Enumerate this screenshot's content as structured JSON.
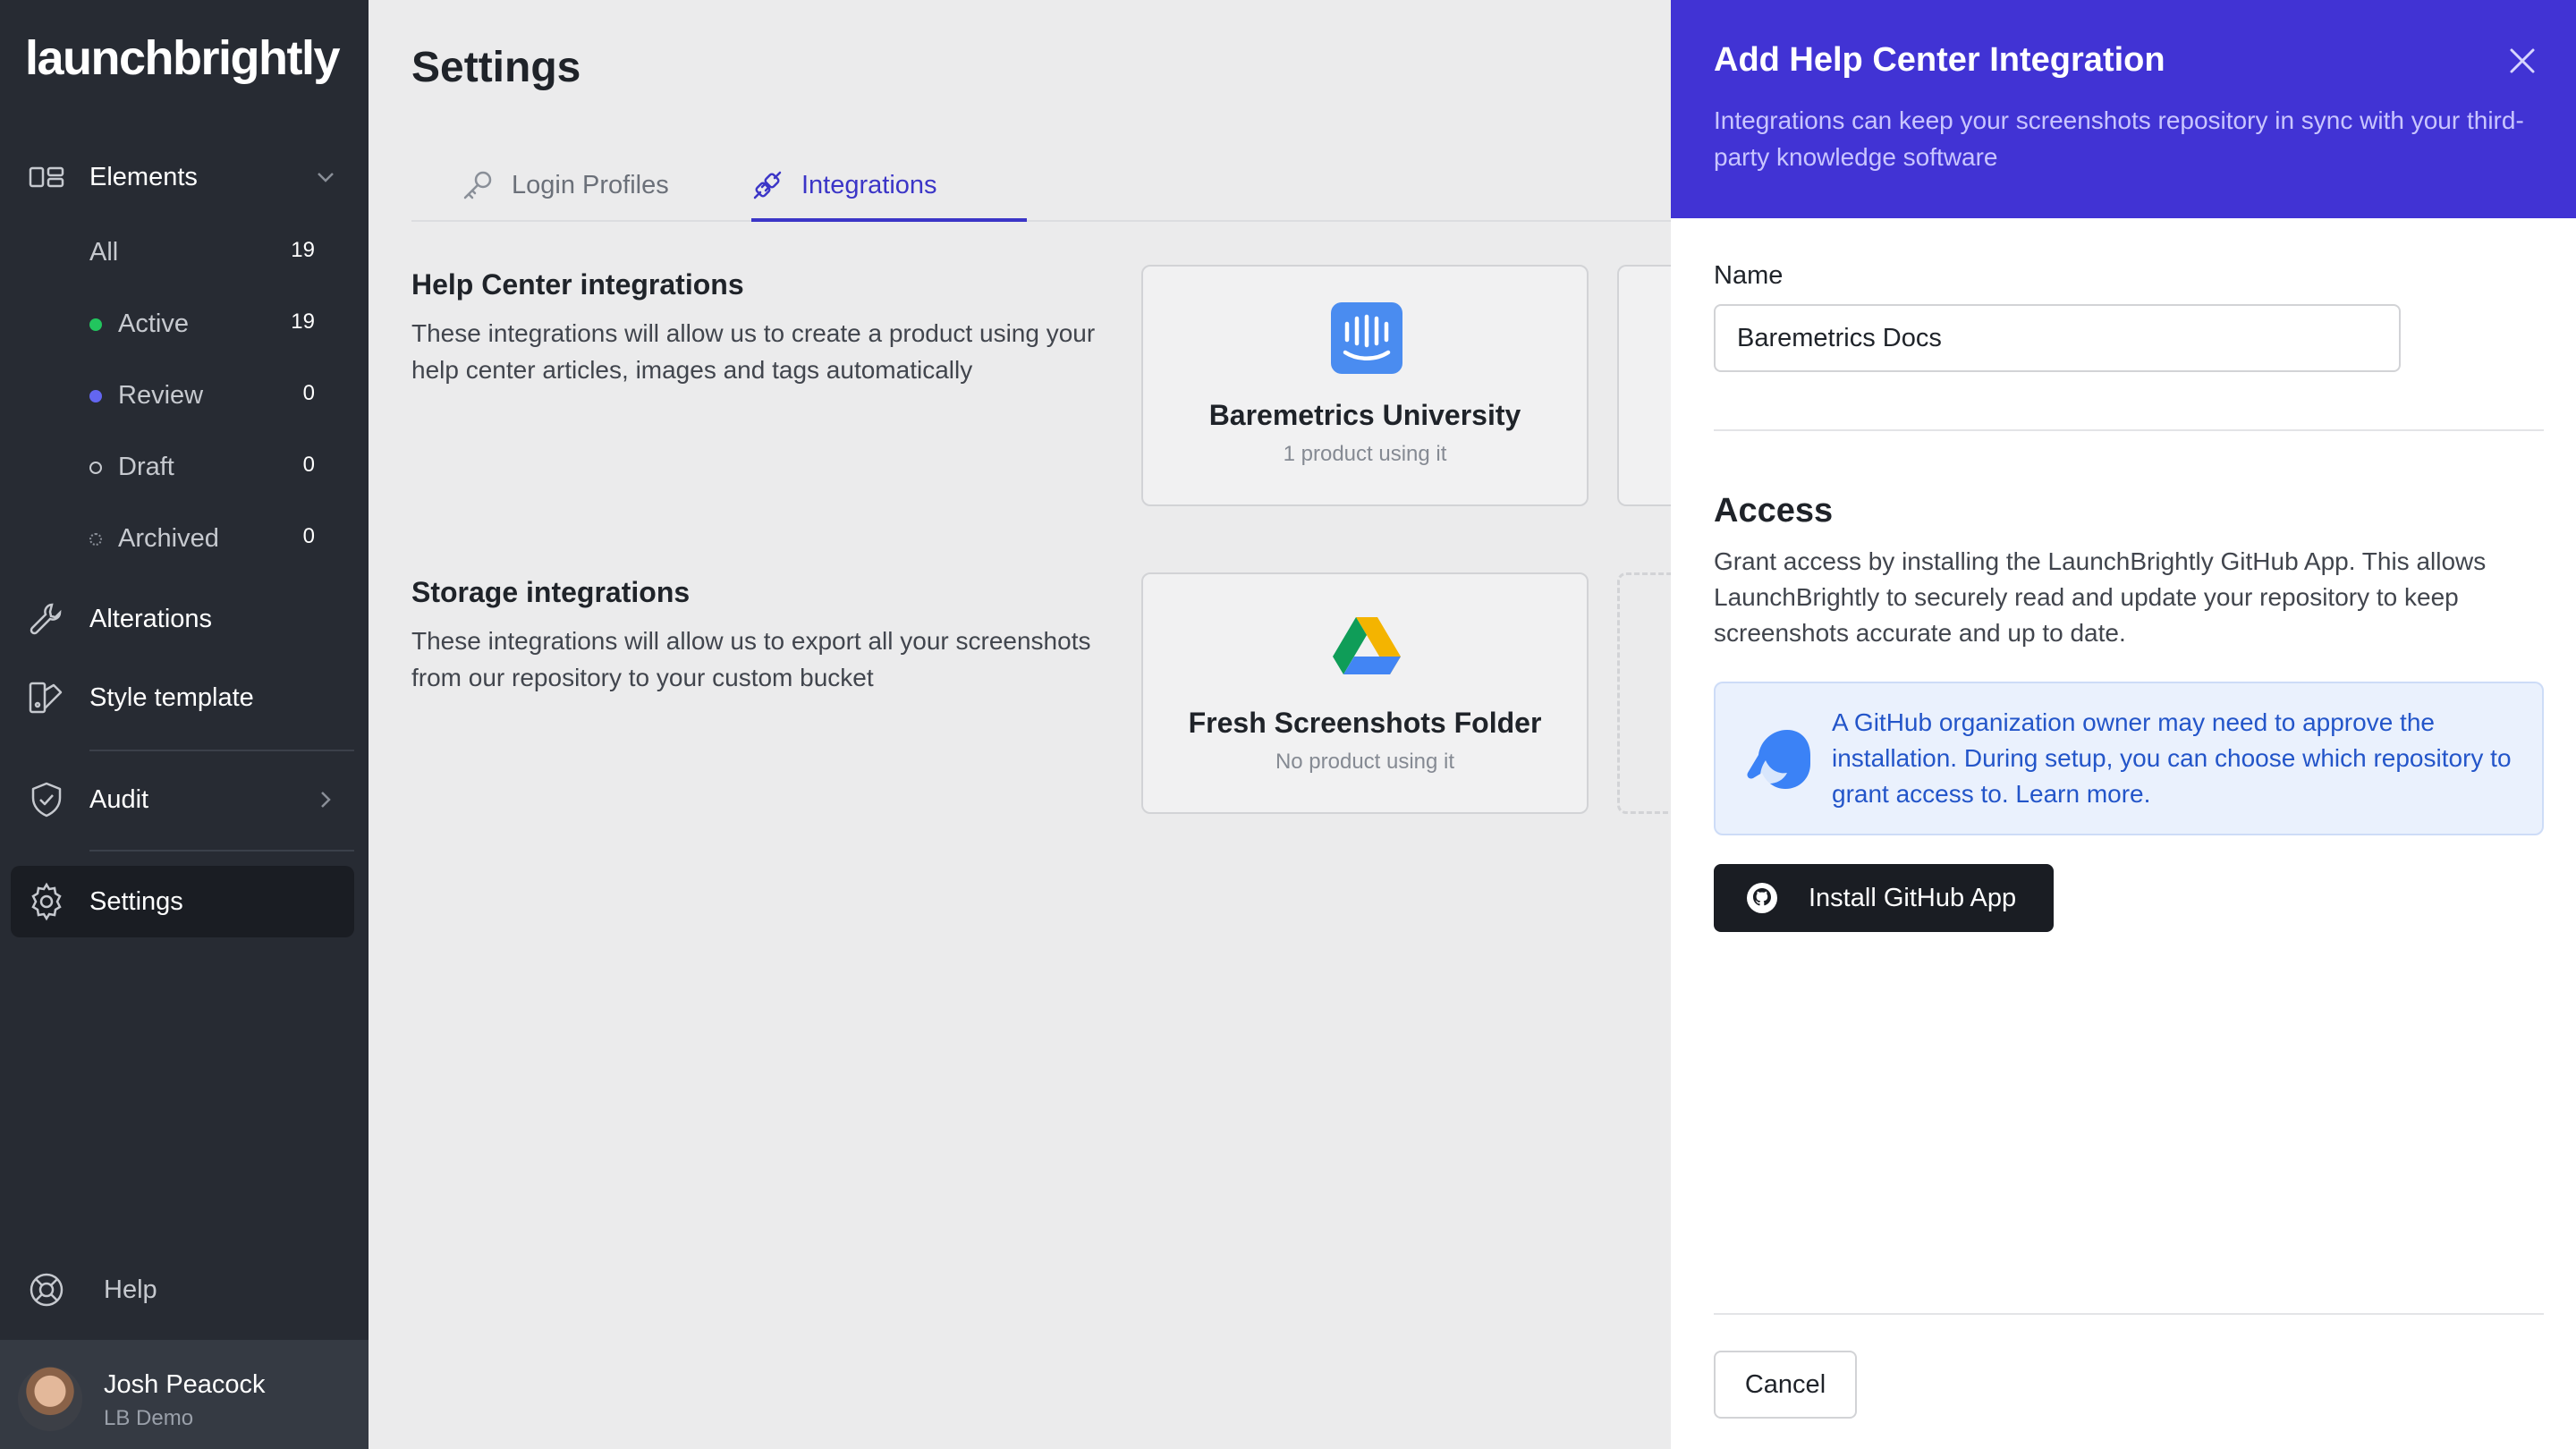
{
  "app": {
    "logo_text": "launchbrightly"
  },
  "sidebar": {
    "elements_label": "Elements",
    "sub_items": [
      {
        "label": "All",
        "count": "19"
      },
      {
        "label": "Active",
        "count": "19",
        "dot_color": "#22c55e"
      },
      {
        "label": "Review",
        "count": "0",
        "dot_color": "#6366f1"
      },
      {
        "label": "Draft",
        "count": "0"
      },
      {
        "label": "Archived",
        "count": "0"
      }
    ],
    "alterations_label": "Alterations",
    "style_template_label": "Style template",
    "audit_label": "Audit",
    "settings_label": "Settings",
    "help_label": "Help",
    "user": {
      "name": "Josh Peacock",
      "org": "LB Demo"
    }
  },
  "main": {
    "title": "Settings",
    "tabs": [
      {
        "label": "Login Profiles"
      },
      {
        "label": "Integrations"
      }
    ],
    "help_center": {
      "title": "Help Center integrations",
      "description": "These integrations will allow us to create a product using your help center articles, images and tags automatically",
      "card": {
        "title": "Baremetrics University",
        "subtitle": "1 product using it"
      }
    },
    "storage": {
      "title": "Storage integrations",
      "description": "These integrations will allow us to export all your screenshots from our repository to your custom bucket",
      "card": {
        "title": "Fresh Screenshots Folder",
        "subtitle": "No product using it"
      }
    }
  },
  "panel": {
    "title": "Add Help Center Integration",
    "description": "Integrations can keep your screenshots repository in sync with your third-party knowledge software",
    "name_label": "Name",
    "name_value": "Baremetrics Docs",
    "access_title": "Access",
    "access_description": "Grant access by installing the LaunchBrightly GitHub App. This allows LaunchBrightly to securely read and update your repository to keep screenshots accurate and up to date.",
    "info_text": "A GitHub organization owner may need to approve the installation. During setup, you can choose which repository to grant access to. Learn more.",
    "install_button": "Install GitHub App",
    "cancel_button": "Cancel"
  },
  "colors": {
    "accent": "#4133d4",
    "tab_active": "#3b35c7",
    "sidebar_bg": "#272b33"
  }
}
